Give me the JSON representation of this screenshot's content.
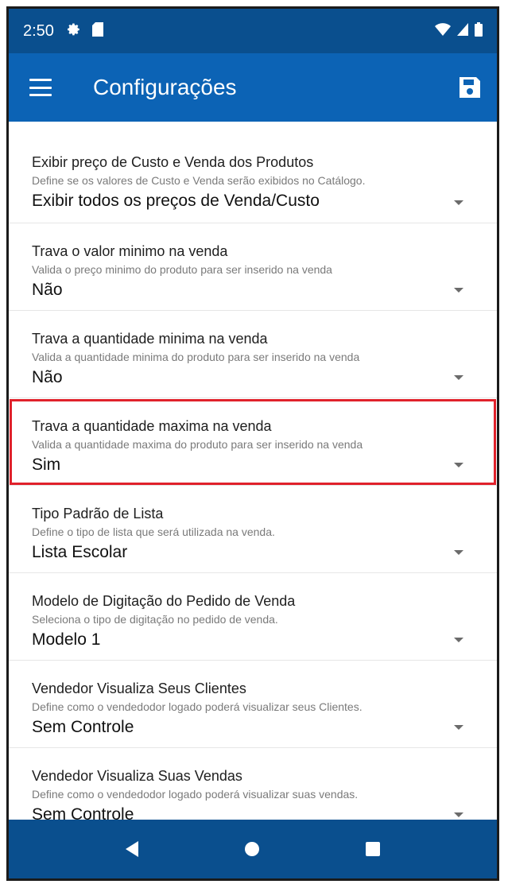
{
  "status": {
    "time": "2:50",
    "left_icons": [
      "gear-icon",
      "sim-card-icon"
    ],
    "right_icons": [
      "wifi-icon",
      "signal-icon",
      "battery-icon"
    ]
  },
  "appbar": {
    "title": "Configurações",
    "menu_icon": "hamburger-menu-icon",
    "save_icon": "save-icon"
  },
  "settings": [
    {
      "title": "Exibir preço de Custo e Venda dos Produtos",
      "description": "Define se os valores de Custo e Venda serão exibidos no Catálogo.",
      "value": "Exibir todos os preços de Venda/Custo"
    },
    {
      "title": "Trava o valor minimo na venda",
      "description": "Valida o preço minimo do produto para ser inserido na venda",
      "value": "Não"
    },
    {
      "title": "Trava a quantidade minima na venda",
      "description": "Valida a quantidade minima do produto para ser inserido na venda",
      "value": "Não"
    },
    {
      "title": "Trava a quantidade maxima na venda",
      "description": "Valida a quantidade maxima do produto para ser inserido na venda",
      "value": "Sim",
      "highlight_color": "#e0212b"
    },
    {
      "title": "Tipo Padrão de Lista",
      "description": "Define o tipo de lista que será utilizada na venda.",
      "value": "Lista Escolar"
    },
    {
      "title": "Modelo de Digitação do Pedido de Venda",
      "description": "Seleciona o tipo de digitação no pedido de venda.",
      "value": "Modelo 1"
    },
    {
      "title": "Vendedor Visualiza Seus Clientes",
      "description": "Define como o vendedodor logado poderá visualizar seus Clientes.",
      "value": "Sem Controle"
    },
    {
      "title": "Vendedor Visualiza Suas Vendas",
      "description": "Define como o vendedodor logado poderá visualizar suas vendas.",
      "value": "Sem Controle"
    }
  ],
  "navbar": {
    "icons": [
      "back-icon",
      "home-icon",
      "recent-apps-icon"
    ]
  },
  "colors": {
    "statusbar": "#0a4f8e",
    "appbar": "#0c63b5",
    "highlight": "#e0212b"
  }
}
